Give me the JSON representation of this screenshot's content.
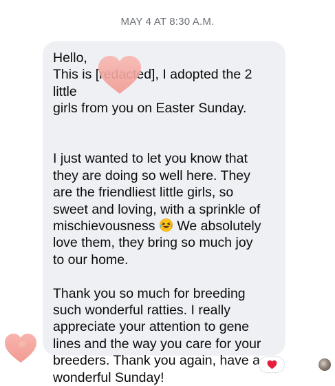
{
  "timestamp": "MAY 4 AT 8:30 A.M.",
  "message": {
    "paragraphs": [
      {
        "lines": [
          "Hello,",
          "This is [redacted], I adopted the 2 little",
          "girls from you on Easter Sunday."
        ]
      },
      {
        "text_before_emoji": "I just wanted to let you know that\nthey are doing so well here. They\nare the friendliest little girls, so\nsweet and loving, with a sprinkle of\nmischievousness ",
        "emoji": "laughing-crying-emoji",
        "text_after_emoji": " We absolutely\nlove them, they bring so much joy\nto our home."
      },
      {
        "text": "Thank you so much for breeding\nsuch wonderful ratties. I really\nappreciate your attention to gene\nlines and the way you care for your\nbreeders. Thank you again, have a\nwonderful Sunday!"
      }
    ]
  },
  "reaction": {
    "icon": "red-heart-icon",
    "color": "#e41e3f"
  },
  "colors": {
    "bubble": "#eef0f4",
    "sticker_heart": "#f4a6a0",
    "timestamp": "#6b6f76"
  }
}
